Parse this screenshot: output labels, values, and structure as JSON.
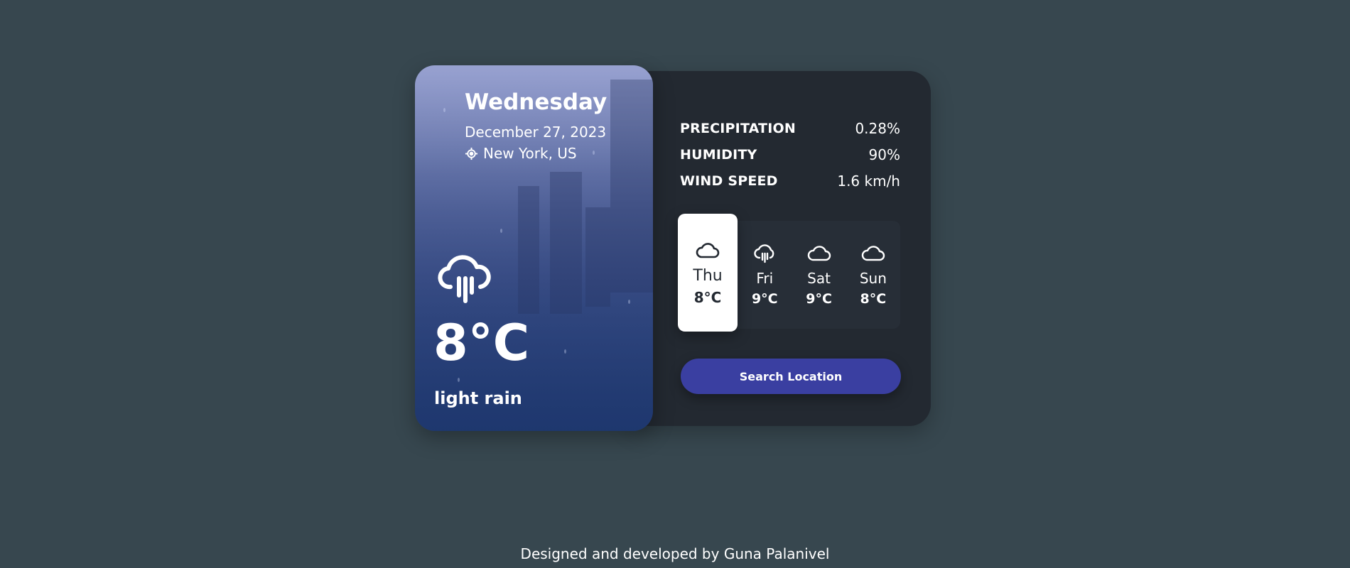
{
  "card": {
    "day": "Wednesday",
    "date": "December 27, 2023",
    "location": "New York, US",
    "location_icon": "location-crosshair-icon",
    "weather_icon": "cloud-rain-icon",
    "temperature": "8°C",
    "condition": "light rain"
  },
  "stats": [
    {
      "label": "PRECIPITATION",
      "value": "0.28%"
    },
    {
      "label": "HUMIDITY",
      "value": "90%"
    },
    {
      "label": "WIND SPEED",
      "value": "1.6 km/h"
    }
  ],
  "forecast": [
    {
      "day": "Thu",
      "temp": "8°C",
      "icon": "cloud-icon",
      "active": true
    },
    {
      "day": "Fri",
      "temp": "9°C",
      "icon": "cloud-rain-icon",
      "active": false
    },
    {
      "day": "Sat",
      "temp": "9°C",
      "icon": "cloud-icon",
      "active": false
    },
    {
      "day": "Sun",
      "temp": "8°C",
      "icon": "cloud-icon",
      "active": false
    }
  ],
  "search_button": {
    "label": "Search Location"
  },
  "footer": {
    "text": "Designed and developed by Guna Palanivel"
  },
  "colors": {
    "page_bg": "#37474f",
    "panel_bg": "#232931",
    "accent": "#3a3fa1",
    "active_day_bg": "#ffffff"
  }
}
